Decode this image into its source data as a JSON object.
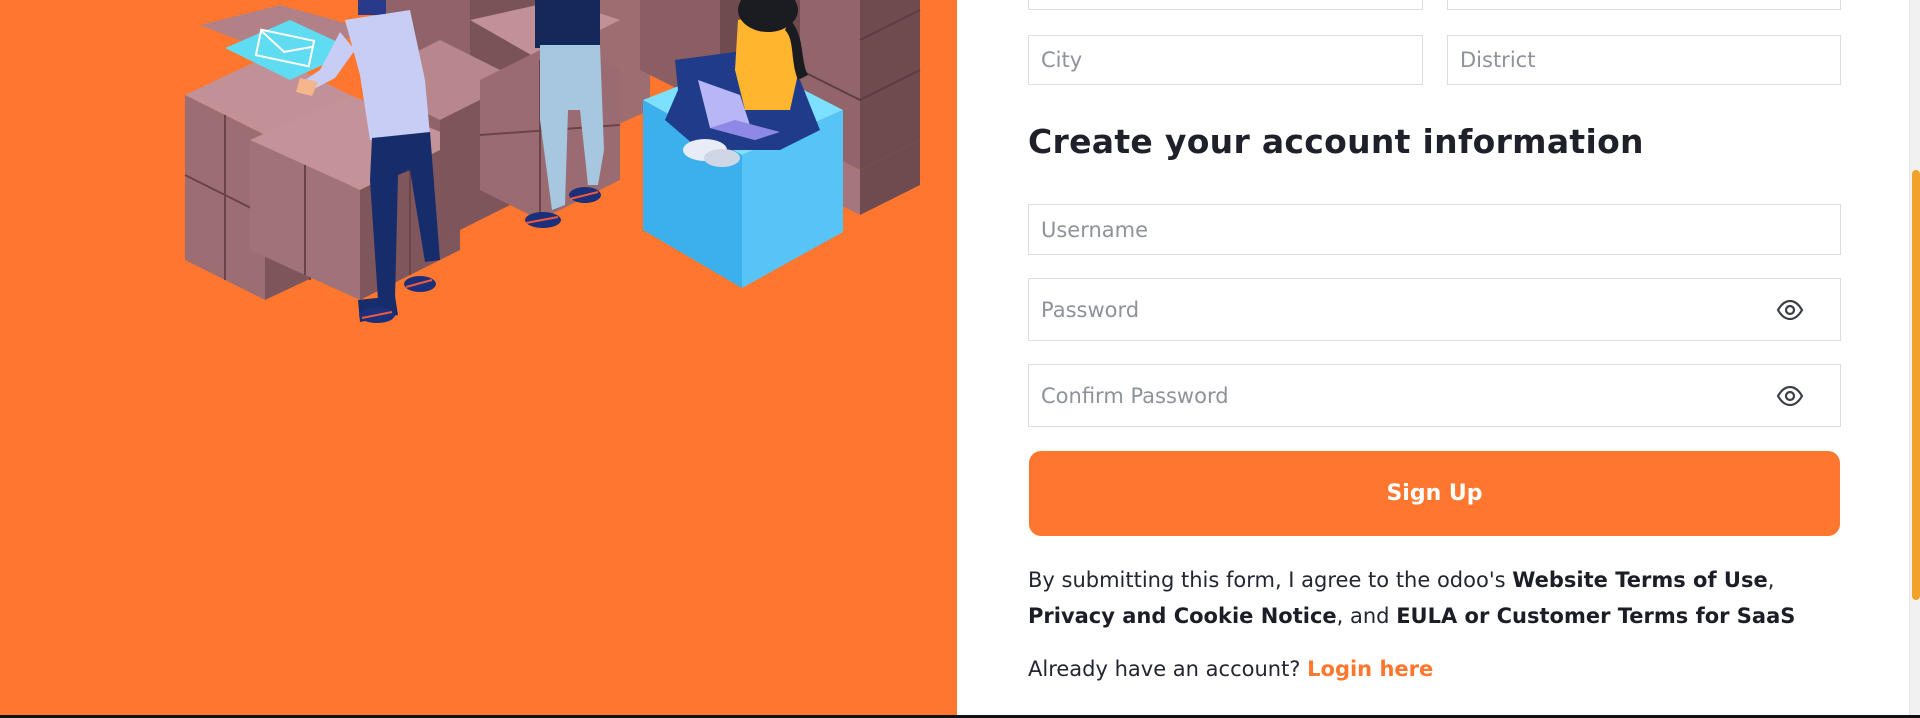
{
  "address": {
    "city_placeholder": "City",
    "district_placeholder": "District"
  },
  "account": {
    "section_title": "Create your account information",
    "username_placeholder": "Username",
    "password_placeholder": "Password",
    "confirm_password_placeholder": "Confirm Password",
    "password_toggle_icon": "eye-icon"
  },
  "signup": {
    "button_label": "Sign Up"
  },
  "terms": {
    "prefix": "By submitting this form, I agree to the odoo's ",
    "website_terms": "Website Terms of Use",
    "sep1": ",",
    "privacy": "Privacy and Cookie Notice",
    "sep2": ", and ",
    "eula": "EULA or Customer Terms for SaaS"
  },
  "login": {
    "prompt": "Already have an account? ",
    "link_label": "Login here"
  },
  "colors": {
    "brand_orange": "#ff772e",
    "text_dark": "#1e2129",
    "border": "#dadde2",
    "placeholder": "#8e939b",
    "scrollbar_thumb": "#f0a22a"
  }
}
